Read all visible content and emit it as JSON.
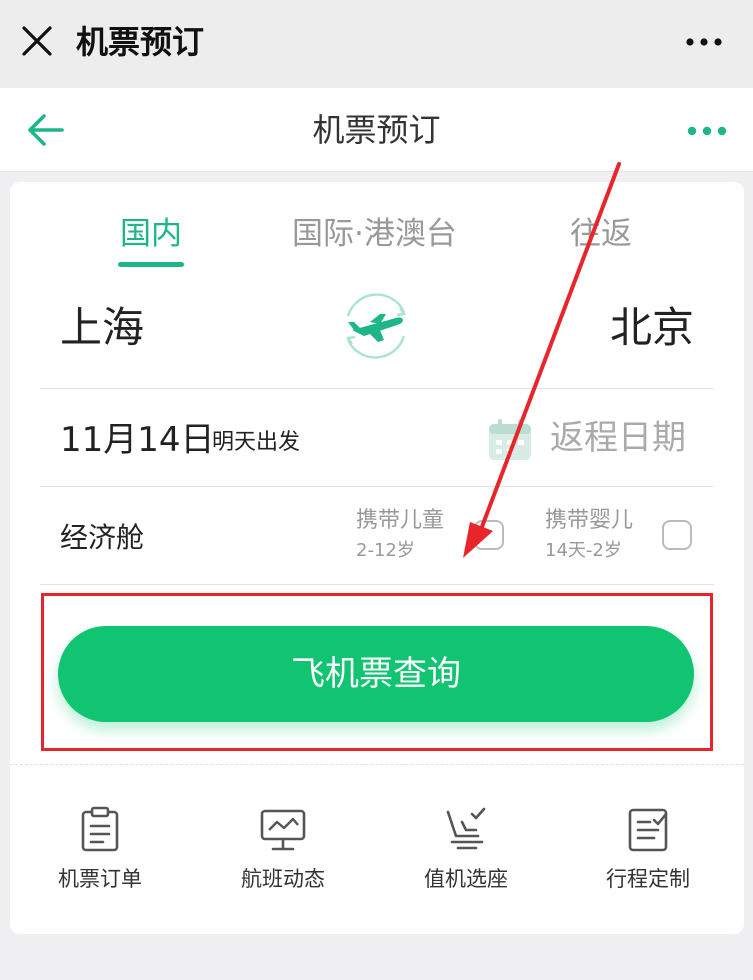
{
  "window": {
    "title": "机票预订"
  },
  "header": {
    "title": "机票预订"
  },
  "tabs": [
    {
      "label": "国内",
      "active": true
    },
    {
      "label": "国际·港澳台",
      "active": false
    },
    {
      "label": "往返",
      "active": false
    }
  ],
  "route": {
    "from": "上海",
    "to": "北京"
  },
  "date": {
    "value": "11月14日",
    "sub": "明天出发",
    "return_placeholder": "返程日期"
  },
  "cabin": {
    "label": "经济舱"
  },
  "passengers": {
    "child": {
      "label": "携带儿童",
      "sub": "2-12岁"
    },
    "infant": {
      "label": "携带婴儿",
      "sub": "14天-2岁"
    }
  },
  "search_button": "飞机票查询",
  "quick_actions": [
    {
      "label": "机票订单",
      "icon": "clipboard-icon"
    },
    {
      "label": "航班动态",
      "icon": "monitor-chart-icon"
    },
    {
      "label": "值机选座",
      "icon": "seat-icon"
    },
    {
      "label": "行程定制",
      "icon": "edit-list-icon"
    }
  ],
  "colors": {
    "accent": "#1fb58a",
    "button": "#10c472",
    "annotation": "#e8252a"
  }
}
